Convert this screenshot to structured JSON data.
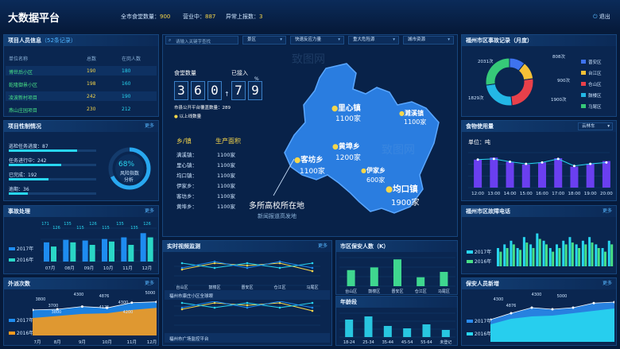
{
  "header": {
    "title": "大数据平台",
    "stats": [
      {
        "label": "全市食堂数量：",
        "value": "900"
      },
      {
        "label": "营业中：",
        "value": "887"
      },
      {
        "label": "异常上报数：",
        "value": "3"
      }
    ],
    "exit": "退出"
  },
  "personnel": {
    "title": "项目人员信息",
    "count": "（52条记录）",
    "headers": [
      "单位名称",
      "总数",
      "在岗人数"
    ],
    "rows": [
      {
        "name": "博世后小区",
        "total": "190",
        "onduty": "180"
      },
      {
        "name": "乾隆御景小区",
        "total": "198",
        "onduty": "160"
      },
      {
        "name": "凌波新村项目",
        "total": "242",
        "onduty": "190"
      },
      {
        "name": "燕山庄园项目",
        "total": "230",
        "onduty": "212"
      }
    ]
  },
  "control": {
    "title": "项目性制情况",
    "more": "更多",
    "lines": [
      "巡检任务进度：87",
      "任务进行中：242",
      "已完成：192",
      "逾期：36"
    ],
    "gauge_pct": "68%",
    "gauge_label1": "风险指数",
    "gauge_label2": "分析",
    "gauge_value": 0.68
  },
  "incidents": {
    "title": "事故处理",
    "more": "更多",
    "legend": [
      "2017年",
      "2016年"
    ],
    "chart_data": {
      "type": "bar",
      "categories": [
        "07月",
        "08月",
        "09月",
        "10月",
        "11月",
        "12月"
      ],
      "series": [
        {
          "name": "2017年",
          "values": [
            115,
            130,
            126,
            135,
            145,
            170
          ]
        },
        {
          "name": "2016年",
          "values": [
            90,
            115,
            100,
            120,
            100,
            145
          ]
        }
      ],
      "labels": [
        "171",
        "126",
        "135",
        "115",
        "126",
        "115",
        "135",
        "135",
        "126"
      ],
      "ylim": [
        0,
        200
      ]
    }
  },
  "outbound": {
    "title": "外派次数",
    "more": "更多",
    "legend": [
      "2017年",
      "2016年"
    ],
    "chart_data": {
      "type": "area",
      "categories": [
        "7月",
        "8月",
        "9月",
        "10月",
        "11月",
        "12月"
      ],
      "series": [
        {
          "name": "2017年",
          "values": [
            3800,
            3900,
            4300,
            4100,
            4876,
            5000
          ]
        },
        {
          "name": "2016年",
          "values": [
            2600,
            2900,
            3200,
            3300,
            3800,
            4100
          ]
        }
      ],
      "labels": [
        "3800",
        "3700",
        "4300",
        "4876",
        "4300",
        "5000",
        "4200",
        "3800",
        "4125"
      ],
      "ylim": [
        0,
        5200
      ]
    }
  },
  "search": {
    "placeholder": "请输入关键字查找",
    "dropdowns": [
      "景区",
      "快速反应力量",
      "重大危险源",
      "城市资源"
    ]
  },
  "canteen": {
    "count_label": "食堂数量",
    "digits": [
      "3",
      "6",
      "0"
    ],
    "arrow": "↑",
    "connected_label": "已接入",
    "connected_digits": [
      "7",
      "9"
    ],
    "pct_sign": "%",
    "public_note": "市县公开平台覆盖数量：289",
    "above_note": "以上线数量"
  },
  "towns": {
    "head_town": "乡/镇",
    "head_area": "生产面积",
    "rows": [
      {
        "town": "满溪镇：",
        "area": "1100家"
      },
      {
        "town": "里心镇：",
        "area": "1100家"
      },
      {
        "town": "均口镇：",
        "area": "1100家"
      },
      {
        "town": "伊家乡：",
        "area": "1100家"
      },
      {
        "town": "客坊乡：",
        "area": "1100家"
      },
      {
        "town": "黄埠乡：",
        "area": "1100家"
      }
    ]
  },
  "map": {
    "markers": [
      {
        "name": "里心镇",
        "value": "1100家"
      },
      {
        "name": "濉溪镇",
        "value": "1100家"
      },
      {
        "name": "黄埠乡",
        "value": "1200家"
      },
      {
        "name": "客坊乡",
        "value": "1100家"
      },
      {
        "name": "伊家乡",
        "value": "600家"
      },
      {
        "name": "均口镇",
        "value": "1900家"
      }
    ],
    "callout": "多所高校所在地",
    "callout_sub": "新闻报道高发地",
    "watermark": "致图网"
  },
  "video": {
    "title": "实时视频监测",
    "more": "更多",
    "chart_data": {
      "type": "line",
      "categories": [
        "台山区",
        "鼓楼区",
        "晋安区",
        "仓江区",
        "马尾区"
      ],
      "series": [
        {
          "values": [
            20,
            28,
            25,
            28,
            18
          ]
        },
        {
          "values": [
            28,
            22,
            28,
            22,
            28
          ]
        },
        {
          "values": [
            22,
            30,
            22,
            30,
            22
          ]
        }
      ]
    },
    "caption1": "福州市康庄小区全球眼",
    "caption2": "福州市广场监控平台"
  },
  "guards": {
    "title": "市区保安人数（K）",
    "chart_data": {
      "type": "bar",
      "categories": [
        "台山区",
        "鼓楼区",
        "晋安区",
        "仓江区",
        "马尾区"
      ],
      "values": [
        18,
        21,
        30,
        10,
        16
      ],
      "ylim": [
        0,
        32
      ]
    }
  },
  "age": {
    "title": "年龄段",
    "chart_data": {
      "type": "bar",
      "categories": [
        "18-24",
        "25-34",
        "35-44",
        "45-54",
        "55-64",
        "未登记"
      ],
      "values": [
        22,
        26,
        14,
        11,
        16,
        9
      ],
      "ylim": [
        0,
        30
      ]
    }
  },
  "accidents": {
    "title": "福州市区事故记录（月度）",
    "chart_data": {
      "type": "pie",
      "labels": [
        "晋安区",
        "台江区",
        "仓山区",
        "鼓楼区",
        "马尾区"
      ],
      "values": [
        808,
        900,
        1900,
        1829,
        2031
      ],
      "value_labels": [
        "808次",
        "900次",
        "1900次",
        "1829次",
        "2031次"
      ],
      "colors": [
        "#3e73f0",
        "#f5c137",
        "#e8404a",
        "#23b7e5",
        "#36c978"
      ]
    }
  },
  "food": {
    "title": "食物使用量",
    "select": "云林车",
    "unit": "单位：吨",
    "chart_data": {
      "type": "bar",
      "categories": [
        "12:00",
        "13:00",
        "14:00",
        "15:00",
        "16:00",
        "17:00",
        "18:00",
        "19:00",
        "20:00"
      ],
      "values": [
        40,
        43,
        37,
        33,
        36,
        42,
        30,
        34,
        38
      ],
      "line_values": [
        40,
        41,
        37,
        34,
        36,
        41,
        31,
        34,
        36
      ],
      "ylim": [
        0,
        50
      ]
    }
  },
  "faults": {
    "title": "福州市区故障电话",
    "more": "更多",
    "legend": [
      "2017年",
      "2016年"
    ],
    "chart_data": {
      "type": "bar",
      "series": [
        {
          "name": "2017年",
          "values": [
            10,
            12,
            14,
            10,
            16,
            12,
            18,
            14,
            10,
            12,
            14,
            16,
            12,
            14,
            16,
            12,
            10,
            14
          ]
        },
        {
          "name": "2016年",
          "values": [
            8,
            10,
            12,
            9,
            13,
            10,
            15,
            12,
            8,
            10,
            12,
            13,
            10,
            12,
            13,
            10,
            8,
            12
          ]
        }
      ],
      "ylim": [
        0,
        20
      ]
    }
  },
  "newstaff": {
    "title": "保安人员新增",
    "more": "更多",
    "legend": [
      "2017年",
      "2016年"
    ],
    "chart_data": {
      "type": "area",
      "series": [
        {
          "name": "2017年",
          "values": [
            2800,
            3600,
            4300,
            4100,
            4300,
            4876,
            5000
          ]
        },
        {
          "name": "2016年",
          "values": [
            2200,
            2900,
            3200,
            3300,
            3600,
            3900,
            4200
          ]
        }
      ],
      "labels": [
        "4300",
        "4876",
        "4300",
        "5000"
      ],
      "ylim": [
        0,
        5200
      ]
    }
  },
  "colors": {
    "bg": "#061a3a",
    "panel": "#0a2650",
    "accent": "#28d6f0",
    "yellow": "#f6d64a",
    "green": "#47e087",
    "map": "#2a7de0"
  }
}
